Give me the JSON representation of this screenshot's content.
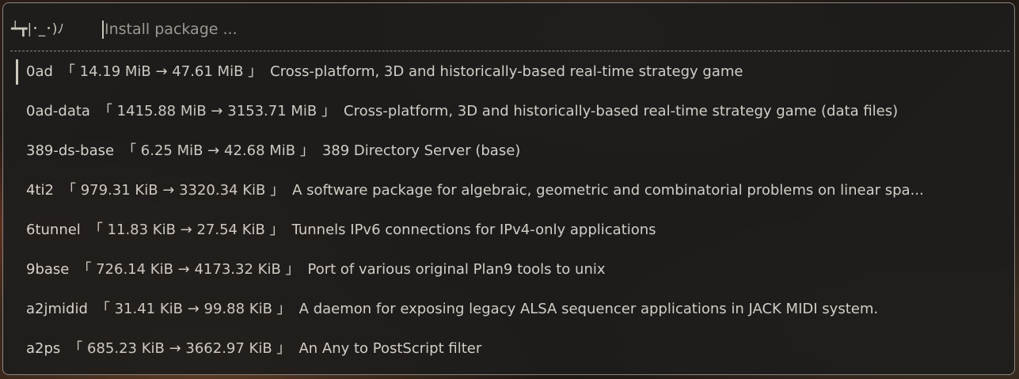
{
  "prompt": {
    "glyph": "┷┳|･_･)ﾉ",
    "placeholder": "Install package ..."
  },
  "results": [
    {
      "name": "0ad",
      "size": "「 14.19 MiB → 47.61 MiB 」",
      "desc": "Cross-platform, 3D and historically-based real-time strategy game",
      "selected": true
    },
    {
      "name": "0ad-data",
      "size": "「 1415.88 MiB → 3153.71 MiB 」",
      "desc": "Cross-platform, 3D and historically-based real-time strategy game (data files)",
      "selected": false
    },
    {
      "name": "389-ds-base",
      "size": "「 6.25 MiB → 42.68 MiB 」",
      "desc": "389 Directory Server (base)",
      "selected": false
    },
    {
      "name": "4ti2",
      "size": "「 979.31 KiB → 3320.34 KiB 」",
      "desc": "A software package for algebraic, geometric and combinatorial problems on linear spa...",
      "selected": false
    },
    {
      "name": "6tunnel",
      "size": "「 11.83 KiB → 27.54 KiB 」",
      "desc": "Tunnels IPv6 connections for IPv4-only applications",
      "selected": false
    },
    {
      "name": "9base",
      "size": "「 726.14 KiB → 4173.32 KiB 」",
      "desc": "Port of various original Plan9 tools to unix",
      "selected": false
    },
    {
      "name": "a2jmidid",
      "size": "「 31.41 KiB → 99.88 KiB 」",
      "desc": "A daemon for exposing legacy ALSA sequencer applications in JACK MIDI system.",
      "selected": false
    },
    {
      "name": "a2ps",
      "size": "「 685.23 KiB → 3662.97 KiB 」",
      "desc": "An Any to PostScript filter",
      "selected": false
    }
  ]
}
